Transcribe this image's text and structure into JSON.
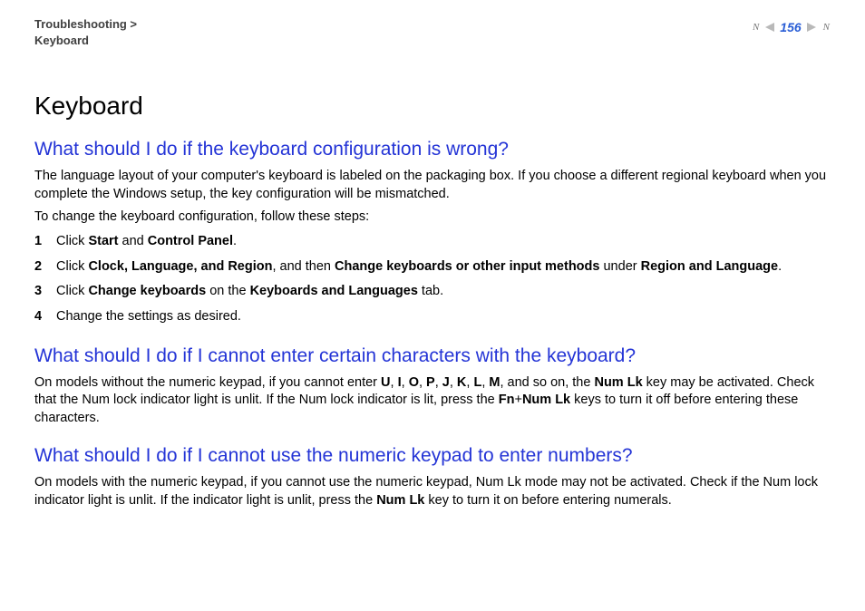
{
  "breadcrumb": {
    "line1": "Troubleshooting >",
    "line2": "Keyboard"
  },
  "pager": {
    "page": "156",
    "n_label": "N"
  },
  "title": "Keyboard",
  "section1": {
    "heading": "What should I do if the keyboard configuration is wrong?",
    "para1": "The language layout of your computer's keyboard is labeled on the packaging box. If you choose a different regional keyboard when you complete the Windows setup, the key configuration will be mismatched.",
    "para2": "To change the keyboard configuration, follow these steps:",
    "steps": [
      {
        "n": "1",
        "html": "Click <b>Start</b> and <b>Control Panel</b>."
      },
      {
        "n": "2",
        "html": "Click <b>Clock, Language, and Region</b>, and then <b>Change keyboards or other input methods</b> under <b>Region and Language</b>."
      },
      {
        "n": "3",
        "html": "Click <b>Change keyboards</b> on the <b>Keyboards and Languages</b> tab."
      },
      {
        "n": "4",
        "html": "Change the settings as desired."
      }
    ]
  },
  "section2": {
    "heading": "What should I do if I cannot enter certain characters with the keyboard?",
    "para_html": "On models without the numeric keypad, if you cannot enter <b>U</b>, <b>I</b>, <b>O</b>, <b>P</b>, <b>J</b>, <b>K</b>, <b>L</b>, <b>M</b>, and so on, the <b>Num Lk</b> key may be activated. Check that the Num lock indicator light is unlit. If the Num lock indicator is lit, press the <b>Fn</b>+<b>Num Lk</b> keys to turn it off before entering these characters."
  },
  "section3": {
    "heading": "What should I do if I cannot use the numeric keypad to enter numbers?",
    "para_html": "On models with the numeric keypad, if you cannot use the numeric keypad, Num Lk mode may not be activated. Check if the Num lock indicator light is unlit. If the indicator light is unlit, press the <b>Num Lk</b> key to turn it on before entering numerals."
  }
}
